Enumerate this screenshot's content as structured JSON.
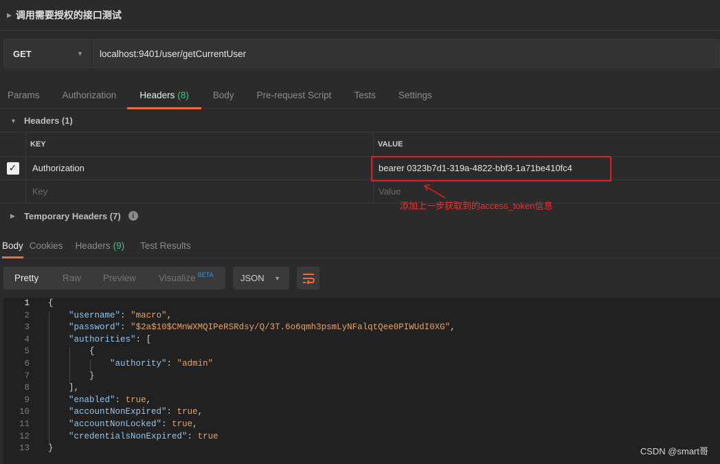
{
  "request": {
    "title": "调用需要授权的接口测试",
    "method": "GET",
    "url": "localhost:9401/user/getCurrentUser"
  },
  "request_tabs": [
    {
      "label": "Params",
      "count": ""
    },
    {
      "label": "Authorization",
      "count": ""
    },
    {
      "label": "Headers",
      "count": "(8)"
    },
    {
      "label": "Body",
      "count": ""
    },
    {
      "label": "Pre-request Script",
      "count": ""
    },
    {
      "label": "Tests",
      "count": ""
    },
    {
      "label": "Settings",
      "count": ""
    }
  ],
  "headers_section": {
    "title": "Headers (1)",
    "col_key": "KEY",
    "col_value": "VALUE",
    "rows": [
      {
        "key": "Authorization",
        "value": "bearer 0323b7d1-319a-4822-bbf3-1a71be410fc4"
      }
    ],
    "key_placeholder": "Key",
    "value_placeholder": "Value",
    "temporary_title": "Temporary Headers (7)"
  },
  "annotation": "添加上一步获取到的access_token信息",
  "response_tabs": [
    {
      "label": "Body",
      "count": ""
    },
    {
      "label": "Cookies",
      "count": ""
    },
    {
      "label": "Headers",
      "count": "(9)"
    },
    {
      "label": "Test Results",
      "count": ""
    }
  ],
  "view_modes": [
    "Pretty",
    "Raw",
    "Preview",
    "Visualize"
  ],
  "beta_label": "BETA",
  "format": "JSON",
  "code_lines": [
    {
      "n": "1",
      "text": "{"
    },
    {
      "n": "2",
      "text": "    \"username\": \"macro\","
    },
    {
      "n": "3",
      "text": "    \"password\": \"$2a$10$CMnWXMQIPeRSRdsy/Q/3T.6o6qmh3psmLyNFalqtQee0PIWUdI0XG\","
    },
    {
      "n": "4",
      "text": "    \"authorities\": ["
    },
    {
      "n": "5",
      "text": "        {"
    },
    {
      "n": "6",
      "text": "            \"authority\": \"admin\""
    },
    {
      "n": "7",
      "text": "        }"
    },
    {
      "n": "8",
      "text": "    ],"
    },
    {
      "n": "9",
      "text": "    \"enabled\": true,"
    },
    {
      "n": "10",
      "text": "    \"accountNonExpired\": true,"
    },
    {
      "n": "11",
      "text": "    \"accountNonLocked\": true,"
    },
    {
      "n": "12",
      "text": "    \"credentialsNonExpired\": true"
    },
    {
      "n": "13",
      "text": "}"
    }
  ],
  "watermark": "CSDN @smart哥",
  "colors": {
    "accent": "#f26b3a",
    "count": "#3fc28b",
    "annotation": "#e02020"
  }
}
